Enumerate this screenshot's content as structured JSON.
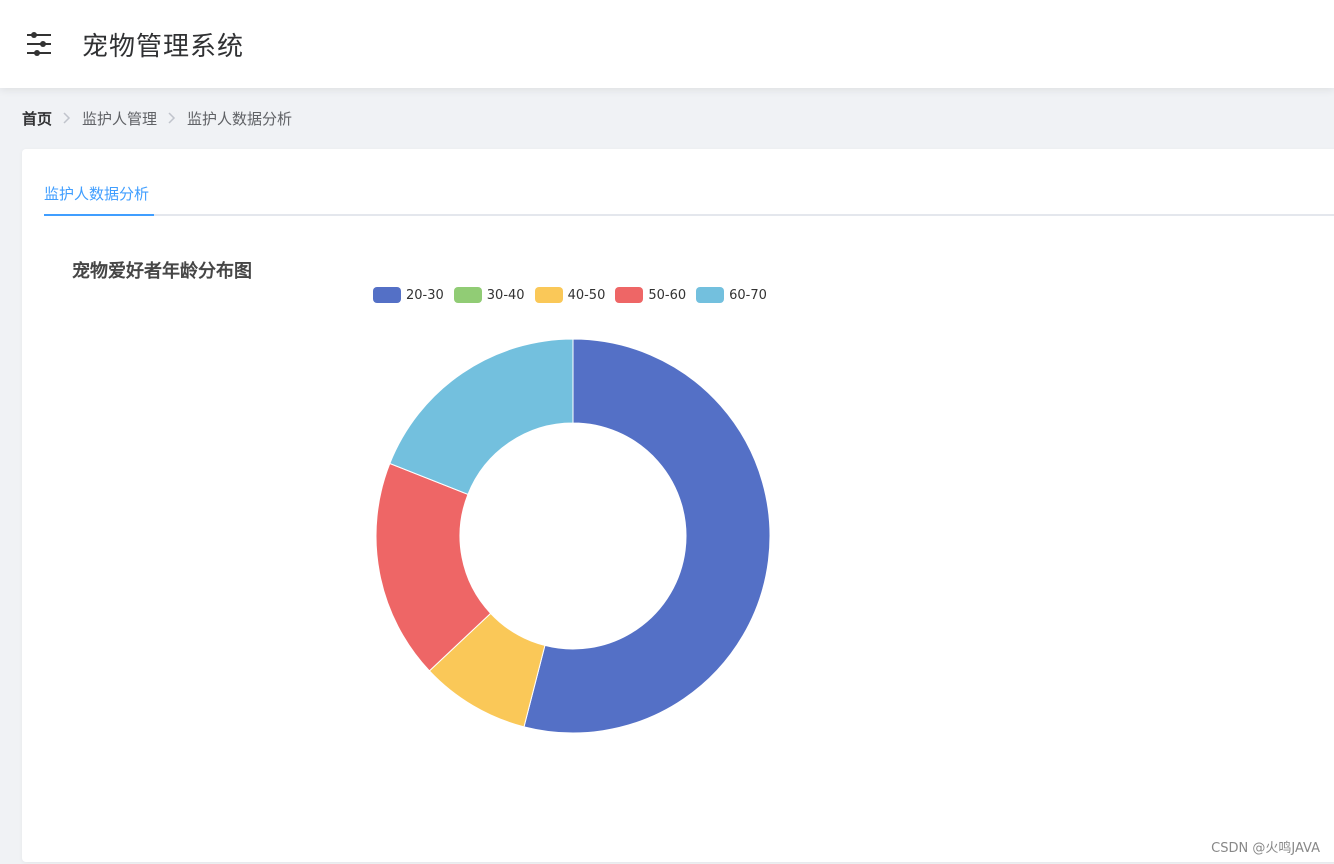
{
  "header": {
    "menu_icon": "sliders-icon",
    "title": "宠物管理系统"
  },
  "breadcrumb": {
    "items": [
      "首页",
      "监护人管理",
      "监护人数据分析"
    ]
  },
  "tabs": [
    {
      "label": "监护人数据分析",
      "active": true
    }
  ],
  "chart_data": {
    "type": "pie",
    "variant": "donut",
    "title": "宠物爱好者年龄分布图",
    "legend_position": "top-center",
    "categories": [
      "20-30",
      "30-40",
      "40-50",
      "50-60",
      "60-70"
    ],
    "values": [
      54,
      0,
      9,
      18,
      19
    ],
    "colors": [
      "#5470c6",
      "#91cc75",
      "#fac858",
      "#ee6666",
      "#73c0de"
    ]
  },
  "watermark": "CSDN @火鸣JAVA"
}
